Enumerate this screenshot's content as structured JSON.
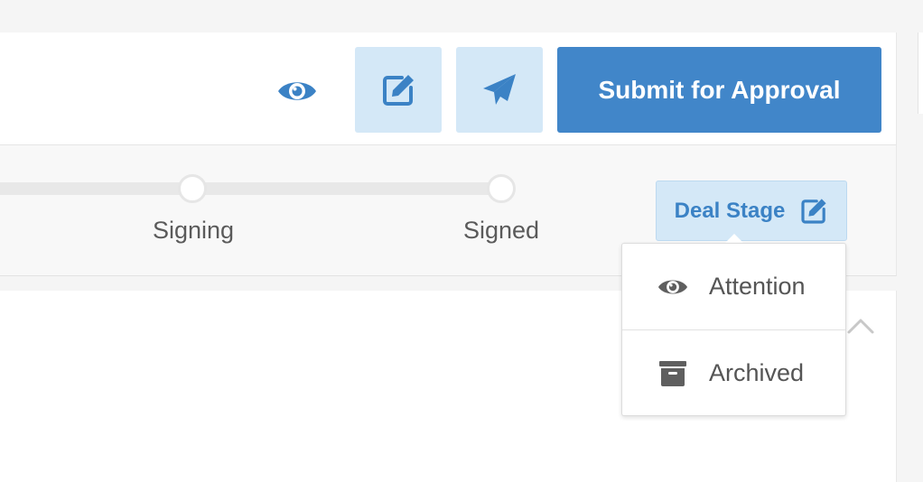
{
  "header": {
    "submit_label": "Submit for Approval",
    "icons": [
      "eye-icon",
      "edit-icon",
      "paper-plane-icon"
    ]
  },
  "stages": [
    {
      "label": "Signing"
    },
    {
      "label": "Signed"
    }
  ],
  "deal_stage": {
    "label": "Deal Stage",
    "icon": "edit-icon"
  },
  "dropdown": {
    "items": [
      {
        "label": "Attention",
        "icon": "eye-icon"
      },
      {
        "label": "Archived",
        "icon": "archive-box-icon"
      }
    ]
  },
  "colors": {
    "primary": "#4186c9",
    "primary_light": "#d4e8f7",
    "icon_blue": "#3b82c5",
    "text_gray": "#5a5a5a",
    "icon_gray": "#5f5f5f"
  }
}
